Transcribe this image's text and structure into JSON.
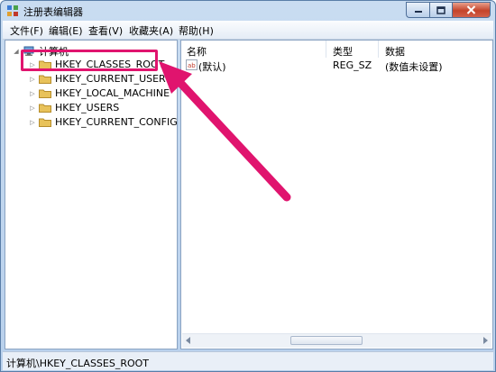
{
  "window": {
    "title": "注册表编辑器",
    "controls": {
      "minimize": "minimize",
      "maximize": "maximize",
      "close": "close"
    }
  },
  "menu": {
    "items": [
      {
        "label": "文件(F)"
      },
      {
        "label": "编辑(E)"
      },
      {
        "label": "查看(V)"
      },
      {
        "label": "收藏夹(A)"
      },
      {
        "label": "帮助(H)"
      }
    ]
  },
  "tree": {
    "root": "计算机",
    "keys": [
      {
        "label": "HKEY_CLASSES_ROOT"
      },
      {
        "label": "HKEY_CURRENT_USER"
      },
      {
        "label": "HKEY_LOCAL_MACHINE"
      },
      {
        "label": "HKEY_USERS"
      },
      {
        "label": "HKEY_CURRENT_CONFIG"
      }
    ]
  },
  "list": {
    "headers": {
      "name": "名称",
      "type": "类型",
      "data": "数据"
    },
    "rows": [
      {
        "name": "(默认)",
        "type": "REG_SZ",
        "data": "(数值未设置)"
      }
    ]
  },
  "status": {
    "path": "计算机\\HKEY_CLASSES_ROOT"
  },
  "colors": {
    "annotation": "#e0146e",
    "folder": "#e8c25a",
    "frame": "#b8d0ec"
  },
  "annotation": {
    "target": "HKEY_CLASSES_ROOT"
  }
}
